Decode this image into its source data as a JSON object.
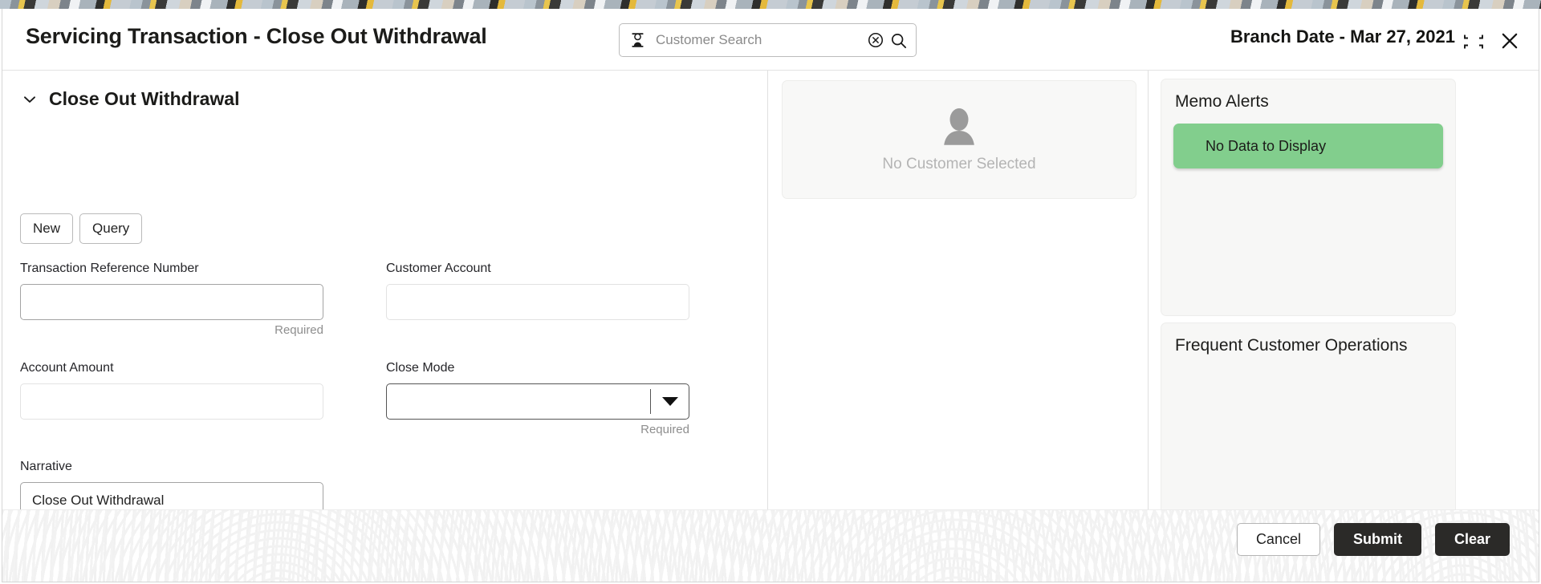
{
  "header": {
    "title": "Servicing Transaction - Close Out Withdrawal",
    "branch_date": "Branch Date - Mar 27, 2021",
    "search_placeholder": "Customer Search",
    "search_value": "",
    "person_icon": "person-icon",
    "clear_icon": "clear-circle-icon",
    "search_icon": "search-icon",
    "collapse_icon": "restore-down-icon",
    "close_icon": "close-icon"
  },
  "form": {
    "section_title": "Close Out Withdrawal",
    "chevron_icon": "chevron-down-icon",
    "buttons": {
      "new": "New",
      "query": "Query"
    },
    "fields": {
      "transaction_reference": {
        "label": "Transaction Reference Number",
        "value": "",
        "helper": "Required"
      },
      "customer_account": {
        "label": "Customer Account",
        "value": "",
        "helper": ""
      },
      "account_amount": {
        "label": "Account Amount",
        "value": "",
        "helper": ""
      },
      "close_mode": {
        "label": "Close Mode",
        "value": "",
        "helper": "Required",
        "arrow_icon": "dropdown-arrow-icon"
      },
      "narrative": {
        "label": "Narrative",
        "value": "Close Out Withdrawal"
      }
    }
  },
  "customer_panel": {
    "avatar_icon": "user-avatar-icon",
    "empty_text": "No Customer Selected"
  },
  "sidebar": {
    "memo_alerts": {
      "title": "Memo Alerts",
      "chip_text": "No Data to Display",
      "chip_color": "#82ce8d"
    },
    "frequent_operations": {
      "title": "Frequent Customer Operations"
    }
  },
  "footer": {
    "cancel": "Cancel",
    "submit": "Submit",
    "clear": "Clear"
  }
}
